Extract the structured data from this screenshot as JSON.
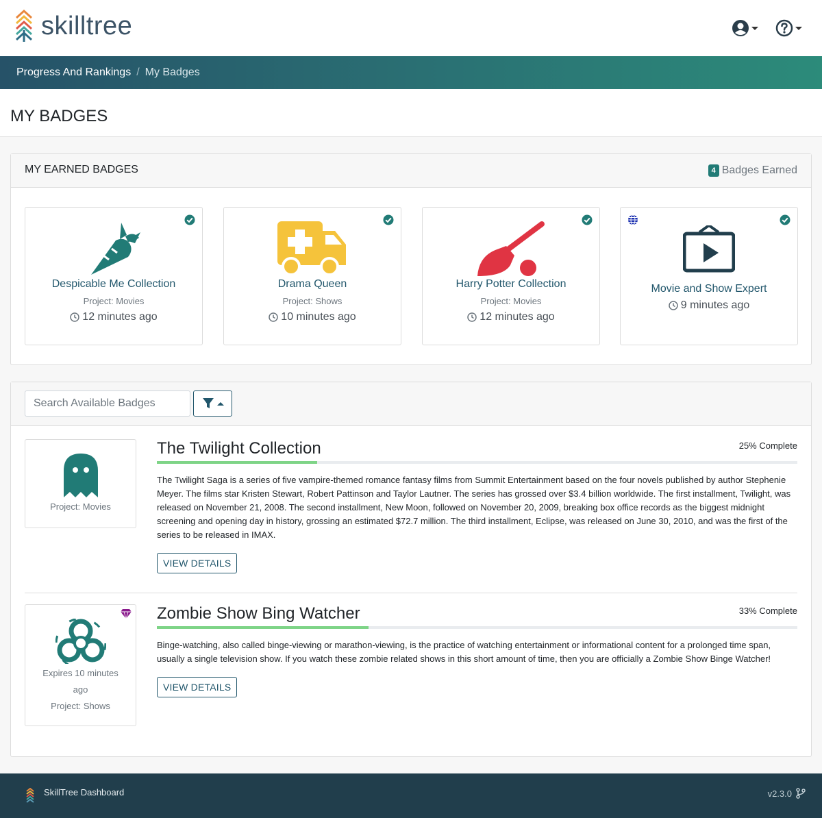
{
  "app": {
    "logo_text": "skilltree",
    "colors": {
      "primary": "#21566b",
      "teal": "#217b76",
      "check": "#217b76",
      "progress": "#7ed487"
    }
  },
  "header": {
    "user_icon": "user-circle-icon",
    "help_icon": "question-circle-icon"
  },
  "breadcrumb": {
    "items": [
      {
        "label": "Progress And Rankings"
      },
      {
        "label": "My Badges"
      }
    ],
    "separator": "/"
  },
  "page": {
    "title": "MY BADGES"
  },
  "earned": {
    "title": "MY EARNED BADGES",
    "count": "4",
    "count_label": "Badges Earned",
    "badges": [
      {
        "name": "Despicable Me Collection",
        "project": "Project: Movies",
        "time": "12 minutes ago",
        "icon": "carrot-icon",
        "color": "#217b76"
      },
      {
        "name": "Drama Queen",
        "project": "Project: Shows",
        "time": "10 minutes ago",
        "icon": "ambulance-icon",
        "color": "#f5c33b"
      },
      {
        "name": "Harry Potter Collection",
        "project": "Project: Movies",
        "time": "12 minutes ago",
        "icon": "broom-icon",
        "color": "#e03443"
      },
      {
        "name": "Movie and Show Expert",
        "project": "",
        "time": "9 minutes ago",
        "icon": "tv-play-icon",
        "color": "#213e4c",
        "global": true
      }
    ]
  },
  "available": {
    "search_placeholder": "Search Available Badges",
    "filter_icon": "filter-icon",
    "items": [
      {
        "title": "The Twilight Collection",
        "percent_label": "25% Complete",
        "percent": 25,
        "project": "Project: Movies",
        "icon": "ghost-icon",
        "description": "The Twilight Saga is a series of five vampire-themed romance fantasy films from Summit Entertainment based on the four novels published by author Stephenie Meyer. The films star Kristen Stewart, Robert Pattinson and Taylor Lautner. The series has grossed over $3.4 billion worldwide. The first installment, Twilight, was released on November 21, 2008. The second installment, New Moon, followed on November 20, 2009, breaking box office records as the biggest midnight screening and opening day in history, grossing an estimated $72.7 million. The third installment, Eclipse, was released on June 30, 2010, and was the first of the series to be released in IMAX.",
        "button": "VIEW DETAILS"
      },
      {
        "title": "Zombie Show Bing Watcher",
        "percent_label": "33% Complete",
        "percent": 33,
        "expires": "Expires 10 minutes ago",
        "project": "Project: Shows",
        "icon": "biohazard-icon",
        "gem_icon": "gem-icon",
        "description": "Binge-watching, also called binge-viewing or marathon-viewing, is the practice of watching entertainment or informational content for a prolonged time span, usually a single television show. If you watch these zombie related shows in this short amount of time, then you are officially a Zombie Show Binge Watcher!",
        "button": "VIEW DETAILS"
      }
    ]
  },
  "footer": {
    "name": "SkillTree Dashboard",
    "version": "v2.3.0",
    "branch_icon": "code-branch-icon"
  }
}
